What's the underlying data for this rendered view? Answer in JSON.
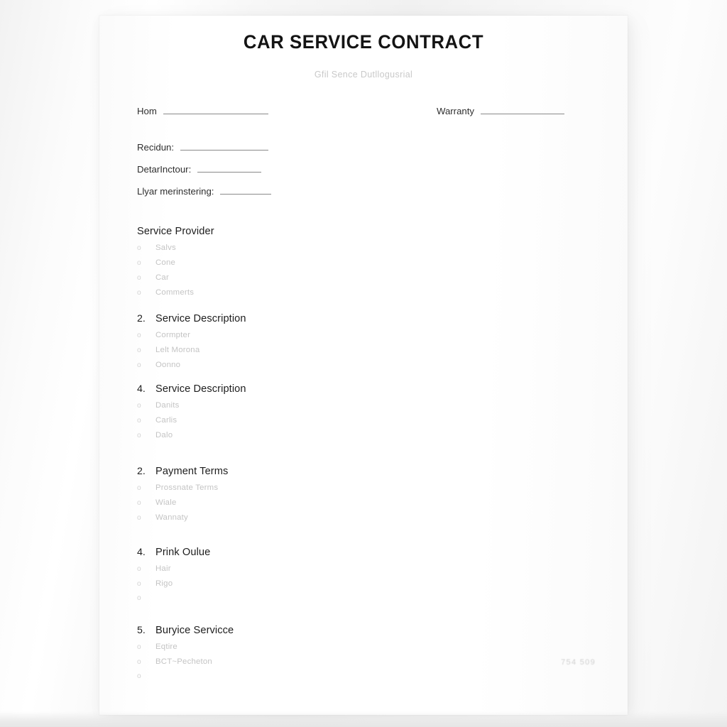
{
  "document": {
    "title": "CAR SERVICE CONTRACT",
    "subtitle": "Gfil Sence Dutllogusrial",
    "footer_stamp": "754 509",
    "page_background": "#ffffff",
    "canvas_background": "#f2f2f2",
    "title_color": "#141414",
    "faint_text_color": "#c4c4c4"
  },
  "fields": {
    "home": {
      "label": "Hom"
    },
    "recidun": {
      "label": "Recidun:"
    },
    "detarinctour": {
      "label": "DetarInctour:"
    },
    "llyar": {
      "label": "Llyar merinstering:"
    },
    "warranty": {
      "label": "Warranty"
    }
  },
  "bullet_glyph": "o",
  "sections": [
    {
      "number": "",
      "title": "Service Provider",
      "items": [
        "Salvs",
        "Cone",
        "Car",
        "Commerts"
      ]
    },
    {
      "number": "2.",
      "title": "Service Description",
      "items": [
        "Cormpter",
        "Lelt Morona",
        "Oonno"
      ]
    },
    {
      "number": "4.",
      "title": "Service Description",
      "items": [
        "Danits",
        "Carlis",
        "Dalo"
      ]
    },
    {
      "number": "2.",
      "title": "Payment Terms",
      "items": [
        "Prossnate Terms",
        "Wiale",
        "Wannaty"
      ]
    },
    {
      "number": "4.",
      "title": "Prink Oulue",
      "items": [
        "Hair",
        "Rigo",
        ""
      ]
    },
    {
      "number": "5.",
      "title": "Buryice Servicce",
      "items": [
        "Eqtire",
        "BCT~Pecheton",
        ""
      ]
    }
  ]
}
